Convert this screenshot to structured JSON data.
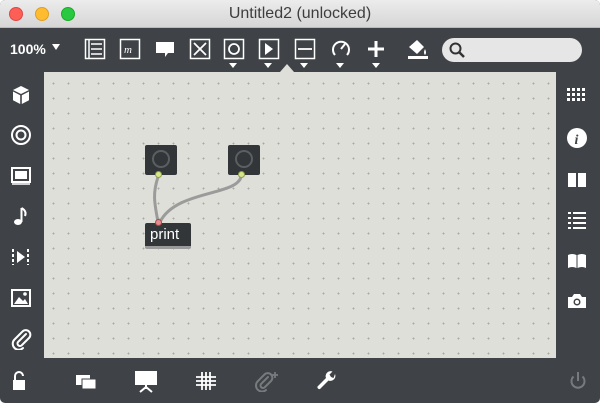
{
  "window": {
    "title": "Untitled2 (unlocked)"
  },
  "toolbar": {
    "zoom": "100%",
    "search": {
      "placeholder": "",
      "value": ""
    },
    "tools": [
      "presentation-mode",
      "comment-text",
      "comment-bubble",
      "toggle",
      "button",
      "number-play",
      "slider",
      "dial",
      "add-object",
      "paint-bucket"
    ]
  },
  "patch": {
    "objects": [
      {
        "type": "button",
        "name": "bang-1"
      },
      {
        "type": "button",
        "name": "bang-2"
      },
      {
        "type": "message",
        "label": "print"
      }
    ]
  },
  "left_sidebar": [
    "cube-icon",
    "target-icon",
    "film-icon",
    "music-note-icon",
    "step-icon",
    "image-icon",
    "paperclip-icon"
  ],
  "right_sidebar": [
    "grid-icon",
    "info-icon",
    "book-open-icon",
    "list-icon",
    "book-icon",
    "camera-icon"
  ],
  "bottom_bar": [
    "lock-icon",
    "windows-icon",
    "presentation-icon",
    "grid-hash-icon",
    "paperclip-add-icon",
    "wrench-icon",
    "power-icon"
  ],
  "colors": {
    "chrome": "#3f4347",
    "canvas": "#dfdfd9",
    "object": "#333638",
    "outlet": "#d7e68c",
    "inlet": "#e58d8d",
    "cable": "#9b9b9b"
  }
}
